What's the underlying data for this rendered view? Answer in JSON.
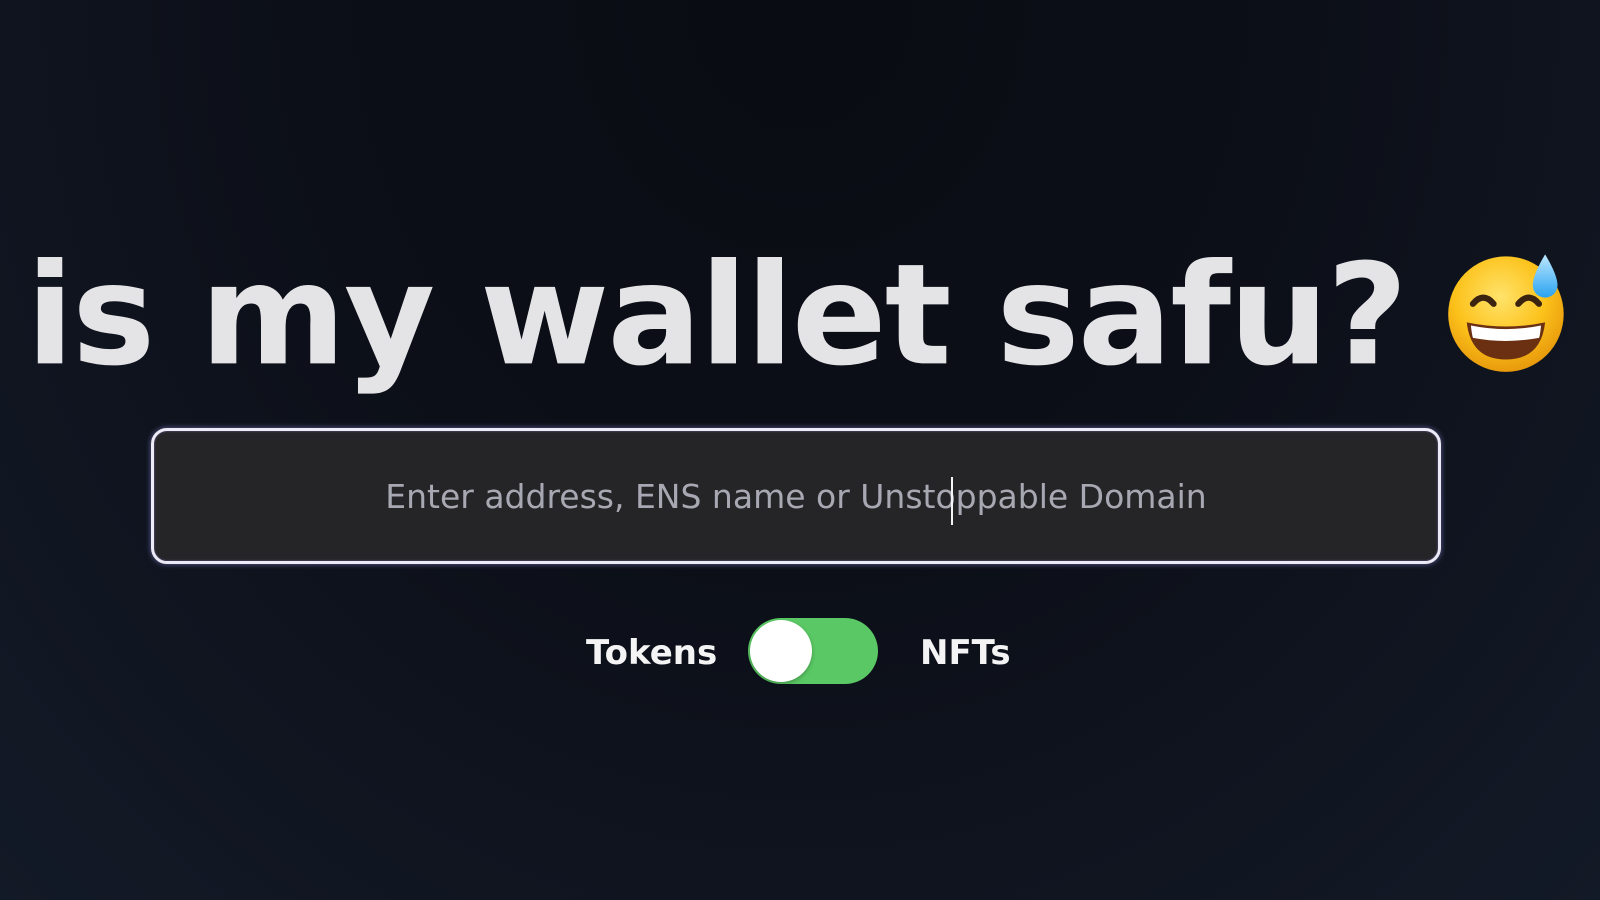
{
  "hero": {
    "title": "is my wallet safu?",
    "emoji_icon": "grinning-face-with-sweat-icon"
  },
  "search": {
    "placeholder": "Enter address, ENS name or Unstoppable Domain",
    "value": ""
  },
  "mode_toggle": {
    "left_label": "Tokens",
    "right_label": "NFTs",
    "state": "on",
    "on_color": "#5ac864"
  },
  "colors": {
    "background": "#0c0f18",
    "heading_text": "#e4e4e7",
    "input_background": "#252528",
    "input_border": "#eceaf6",
    "placeholder_text": "#a8a8b3"
  }
}
